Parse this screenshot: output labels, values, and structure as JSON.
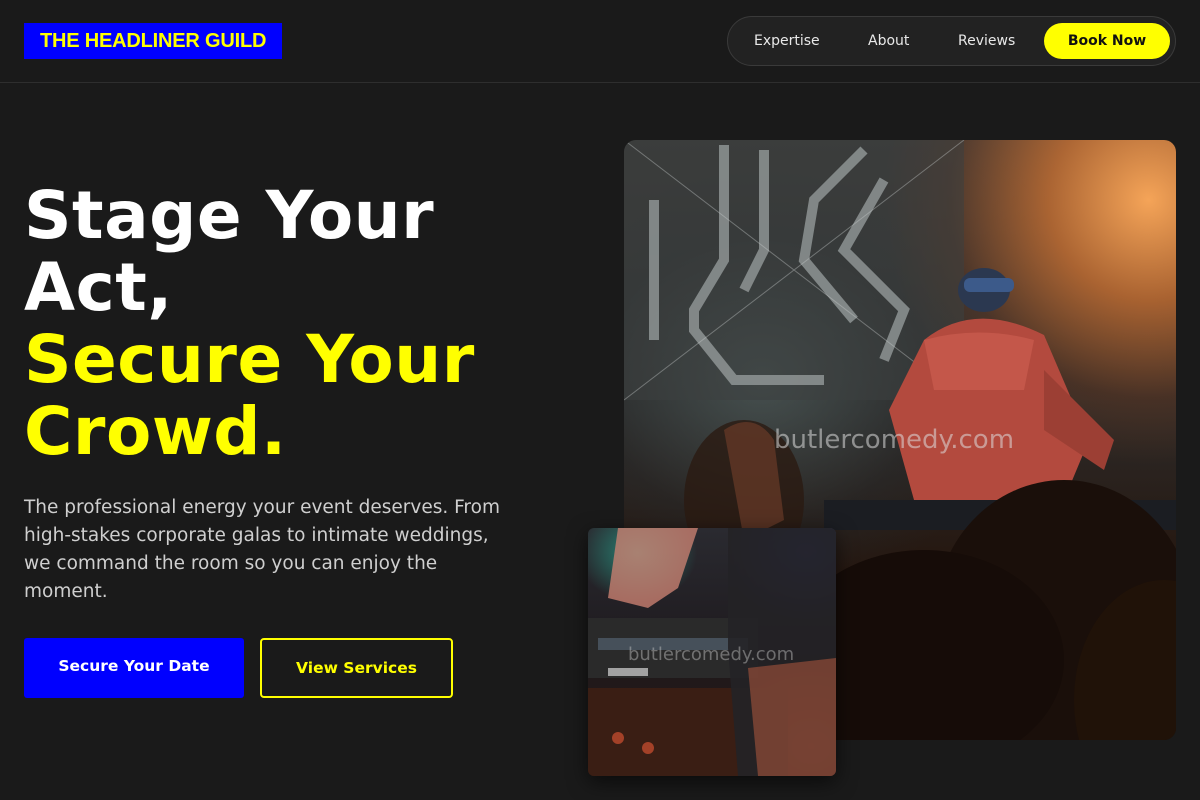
{
  "header": {
    "logo": "THE HEADLINER GUILD",
    "nav": [
      {
        "label": "Expertise"
      },
      {
        "label": "About"
      },
      {
        "label": "Reviews"
      }
    ],
    "cta": "Book Now"
  },
  "hero": {
    "title_lines": [
      "Stage Your",
      "Act,"
    ],
    "title_accent_lines": [
      "Secure Your",
      "Crowd."
    ],
    "subtitle": "The professional energy your event deserves. From high-stakes corporate galas to intimate weddings, we command the room so you can enjoy the moment.",
    "primary_button": "Secure Your Date",
    "secondary_button": "View Services"
  },
  "images": {
    "main_watermark": "butlercomedy.com",
    "small_watermark": "butlercomedy.com"
  },
  "colors": {
    "background": "#1a1a1a",
    "accent_yellow": "#ffff00",
    "accent_blue": "#0000ff"
  }
}
